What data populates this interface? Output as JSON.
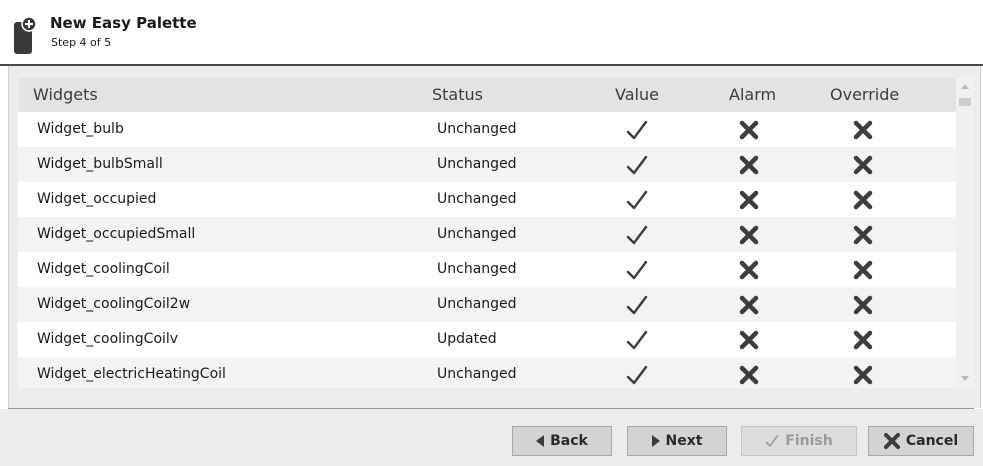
{
  "header": {
    "title": "New Easy Palette",
    "step": "Step 4 of 5",
    "icon": "palette-add-icon"
  },
  "table": {
    "columns": [
      "Widgets",
      "Status",
      "Value",
      "Alarm",
      "Override"
    ],
    "rows": [
      {
        "name": "Widget_bulb",
        "status": "Unchanged",
        "value": "check-icon",
        "alarm": "x-icon",
        "override": "x-icon"
      },
      {
        "name": "Widget_bulbSmall",
        "status": "Unchanged",
        "value": "check-icon",
        "alarm": "x-icon",
        "override": "x-icon"
      },
      {
        "name": "Widget_occupied",
        "status": "Unchanged",
        "value": "check-icon",
        "alarm": "x-icon",
        "override": "x-icon"
      },
      {
        "name": "Widget_occupiedSmall",
        "status": "Unchanged",
        "value": "check-icon",
        "alarm": "x-icon",
        "override": "x-icon"
      },
      {
        "name": "Widget_coolingCoil",
        "status": "Unchanged",
        "value": "check-icon",
        "alarm": "x-icon",
        "override": "x-icon"
      },
      {
        "name": "Widget_coolingCoil2w",
        "status": "Unchanged",
        "value": "check-icon",
        "alarm": "x-icon",
        "override": "x-icon"
      },
      {
        "name": "Widget_coolingCoilv",
        "status": "Updated",
        "value": "check-icon",
        "alarm": "x-icon",
        "override": "x-icon"
      },
      {
        "name": "Widget_electricHeatingCoil",
        "status": "Unchanged",
        "value": "check-icon",
        "alarm": "x-icon",
        "override": "x-icon"
      }
    ]
  },
  "buttons": {
    "back": "Back",
    "next": "Next",
    "finish": "Finish",
    "cancel": "Cancel"
  },
  "colors": {
    "header_rule": "#4a4a4a",
    "panel_bg": "#ececec",
    "row_alt": "#f3f3f3",
    "icon": "#3d3d3d",
    "disabled_text": "#9a9a9a"
  }
}
